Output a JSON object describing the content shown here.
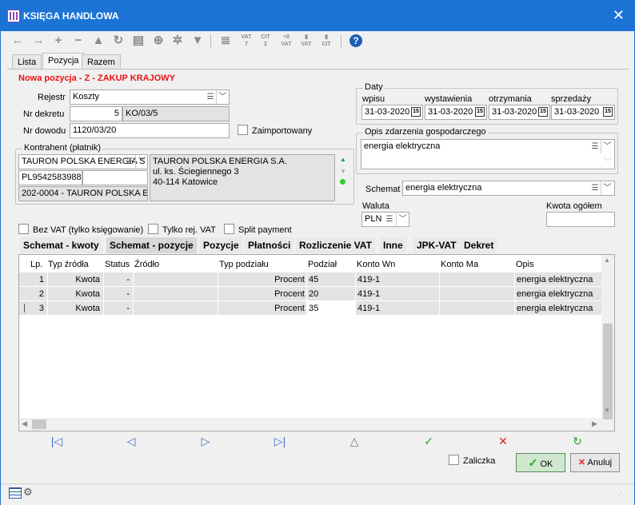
{
  "window": {
    "title": "KSIĘGA HANDLOWA"
  },
  "toolbar": {
    "icons": [
      "arrow-left-icon",
      "arrow-right-icon",
      "plus-icon",
      "minus-icon",
      "triangle-icon",
      "refresh-icon",
      "print-icon",
      "zoom-icon",
      "tools-icon",
      "filter-icon",
      "book-icon"
    ],
    "labels": {
      "vat7": "VAT\n7",
      "cit2": "CIT\n2",
      "vat_a": "VAT",
      "vat_b": "VAT",
      "cit_b": "CIT"
    }
  },
  "tabs": [
    "Lista",
    "Pozycja",
    "Razem"
  ],
  "header": {
    "title": "Nowa pozycja - Z - ZAKUP KRAJOWY"
  },
  "form": {
    "rejestr_label": "Rejestr",
    "rejestr_value": "Koszty",
    "nr_dekretu_label": "Nr dekretu",
    "nr_dekretu_num": "5",
    "nr_dekretu_value": "KO/03/5",
    "nr_dowodu_label": "Nr dowodu",
    "nr_dowodu_value": "1120/03/20",
    "zaimportowany_label": "Zaimportowany"
  },
  "kontrahent": {
    "legend": "Kontrahent (płatnik)",
    "name": "TAURON POLSKA ENERGIA S",
    "nip": "PL9542583988",
    "code": "202-0004 - TAURON POLSKA ENE",
    "address": [
      "TAURON POLSKA ENERGIA S.A.",
      "ul. ks. Ściegiennego 3",
      "40-114 Katowice"
    ]
  },
  "daty": {
    "legend": "Daty",
    "wpisu_label": "wpisu",
    "wystawienia_label": "wystawienia",
    "otrzymania_label": "otrzymania",
    "sprzedazy_label": "sprzedaży",
    "wpisu": "31-03-2020",
    "wystawienia": "31-03-2020",
    "otrzymania": "31-03-2020",
    "sprzedazy": "31-03-2020",
    "cal_label": "15"
  },
  "opis": {
    "legend": "Opis zdarzenia gospodarczego",
    "value": "energia elektryczna"
  },
  "schemat": {
    "label": "Schemat",
    "value": "energia elektryczna"
  },
  "waluta": {
    "label": "Waluta",
    "value": "PLN"
  },
  "kwota": {
    "label": "Kwota ogółem",
    "value": ""
  },
  "options": {
    "bez_vat": "Bez VAT (tylko księgowanie)",
    "tylko_rej": "Tylko rej. VAT",
    "split": "Split payment"
  },
  "inner_tabs": [
    "Schemat - kwoty",
    "Schemat - pozycje",
    "Pozycje",
    "Płatności",
    "Rozliczenie VAT",
    "Inne",
    "JPK-VAT",
    "Dekret"
  ],
  "grid": {
    "headers": [
      "Lp.",
      "Typ źródła",
      "Status",
      "Źródło",
      "Typ podziału",
      "Podział",
      "Konto Wn",
      "Konto Ma",
      "Opis"
    ],
    "rows": [
      {
        "lp": "1",
        "typ": "Kwota",
        "status": "-",
        "zrodlo": "",
        "typ_podzialu": "Procent",
        "podzial": "45",
        "wn": "419-1",
        "ma": "",
        "opis": "energia elektryczna"
      },
      {
        "lp": "2",
        "typ": "Kwota",
        "status": "-",
        "zrodlo": "",
        "typ_podzialu": "Procent",
        "podzial": "20",
        "wn": "419-1",
        "ma": "",
        "opis": "energia elektryczna"
      },
      {
        "lp": "3",
        "typ": "Kwota",
        "status": "-",
        "zrodlo": "",
        "typ_podzialu": "Procent",
        "podzial": "35",
        "wn": "419-1",
        "ma": "",
        "opis": "energia elektryczna"
      }
    ]
  },
  "footer": {
    "zaliczka": "Zaliczka",
    "ok": "OK",
    "anuluj": "Anuluj"
  }
}
